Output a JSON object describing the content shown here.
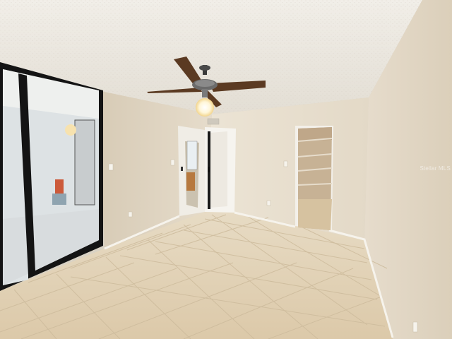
{
  "photo": {
    "watermark": "Stellar MLS"
  },
  "colors": {
    "ceiling": "#ebe7df",
    "wall": "#e5dccb",
    "wall_shadow": "#cfc3ae",
    "floor_tile": "#e2d3b8",
    "grout": "#cbb99b",
    "baseboard": "#f4f1ea",
    "door_frame": "#111111",
    "fan_blade": "#5b3a22",
    "light_globe": "#fffbe8"
  }
}
